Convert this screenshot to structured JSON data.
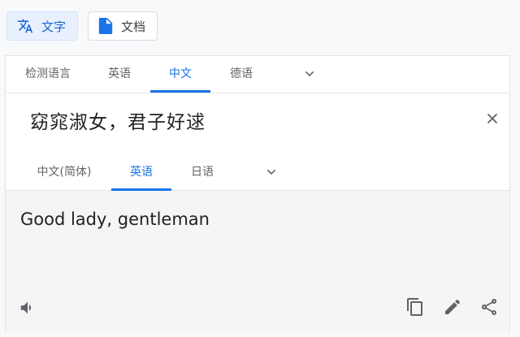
{
  "modes": [
    {
      "label": "文字",
      "icon": "translate-icon",
      "active": true
    },
    {
      "label": "文档",
      "icon": "document-icon",
      "active": false
    }
  ],
  "source_langs": [
    {
      "label": "检测语言",
      "active": false
    },
    {
      "label": "英语",
      "active": false
    },
    {
      "label": "中文",
      "active": true
    },
    {
      "label": "德语",
      "active": false
    }
  ],
  "source_text": "窈窕淑女，君子好逑",
  "target_langs": [
    {
      "label": "中文(简体)",
      "active": false
    },
    {
      "label": "英语",
      "active": true
    },
    {
      "label": "日语",
      "active": false
    }
  ],
  "target_text": "Good lady, gentleman",
  "colors": {
    "accent": "#1a73e8",
    "icon": "#5f6368"
  }
}
